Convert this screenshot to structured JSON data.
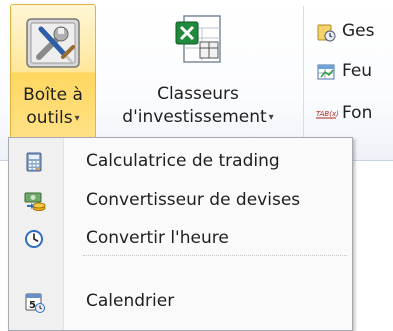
{
  "ribbon": {
    "toolbox": {
      "line1": "Boîte à",
      "line2": "outils",
      "icon": "toolbox-icon"
    },
    "portfolio": {
      "line1": "Classeurs",
      "line2": "d'investissement",
      "icon": "excel-workbook-icon"
    },
    "side_items": [
      {
        "label": "Ges",
        "icon": "manager-icon"
      },
      {
        "label": "Feu",
        "icon": "sheet-icon"
      },
      {
        "label": "Fon",
        "icon": "function-icon"
      }
    ],
    "function_icon_text": "TAB(x)",
    "caret": "▾"
  },
  "menu": {
    "items": [
      {
        "label": "Calculatrice de trading",
        "icon": "calculator-icon"
      },
      {
        "label": "Convertisseur de devises",
        "icon": "currency-converter-icon"
      },
      {
        "label": "Convertir l'heure",
        "icon": "clock-icon"
      },
      {
        "label": "Calendrier",
        "icon": "calendar-icon"
      }
    ],
    "calendar_icon_text": "5"
  },
  "colors": {
    "highlight_border": "#e3b438",
    "highlight_fill": "#ffe48f",
    "menu_bg": "#fafafa",
    "menu_gutter": "#f0f0f0"
  }
}
